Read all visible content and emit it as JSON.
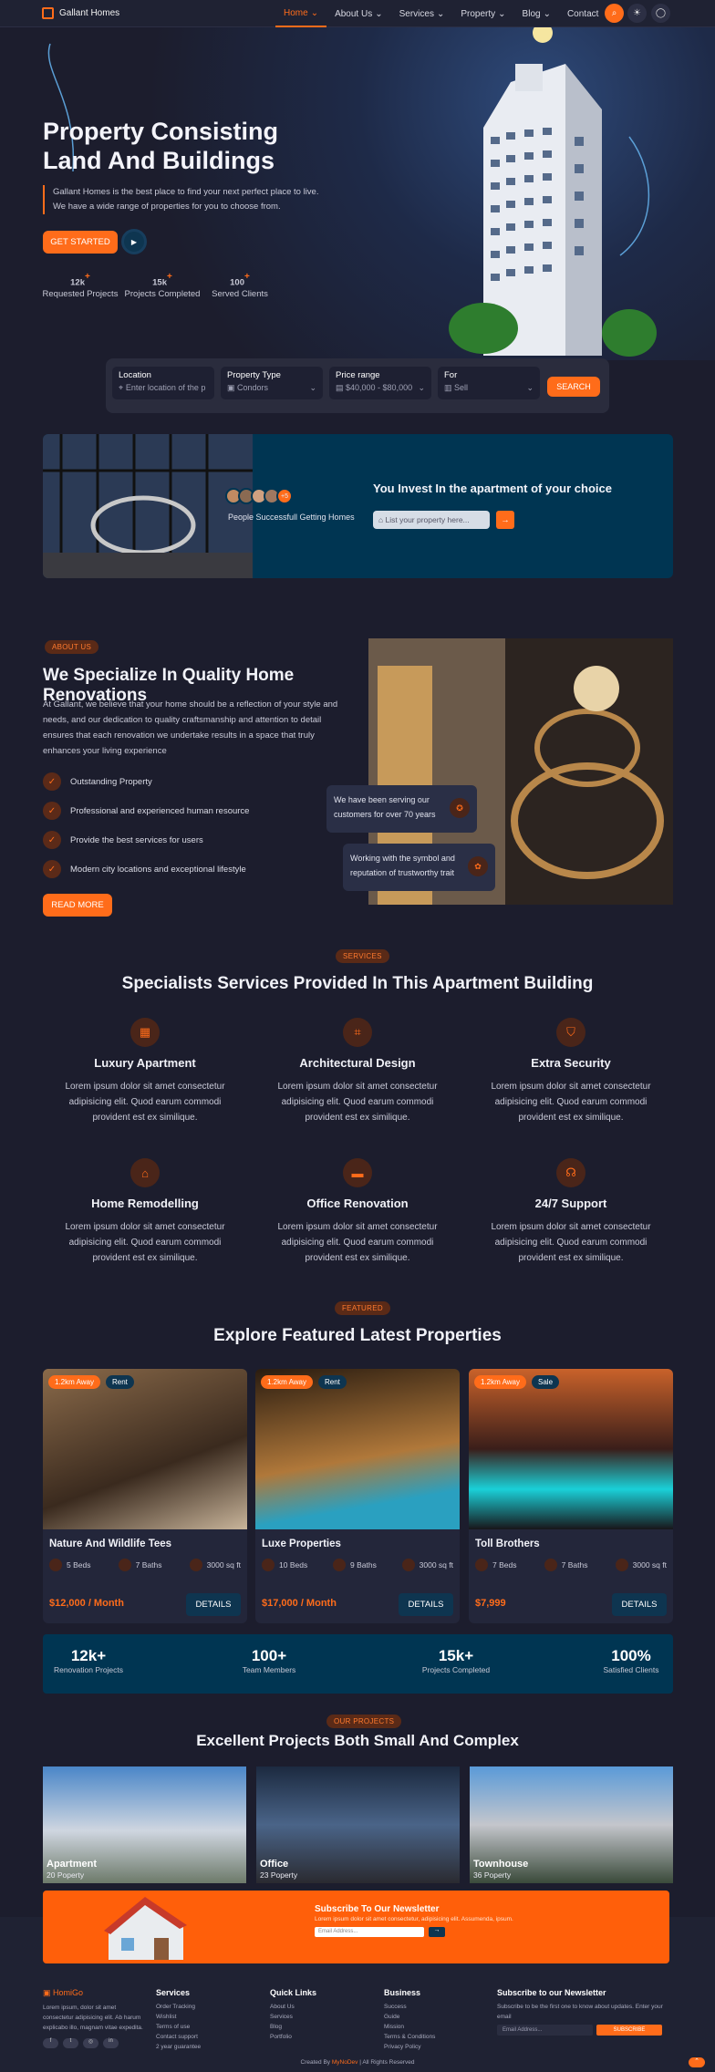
{
  "header": {
    "logo": "Gallant Homes",
    "nav": [
      "Home",
      "About Us",
      "Services",
      "Property",
      "Blog",
      "Contact"
    ]
  },
  "hero": {
    "title": "Property Consisting Land And Buildings",
    "desc": "Gallant Homes is the best place to find your next perfect place to live. We have a wide range of properties for you to choose from.",
    "cta": "GET STARTED",
    "stats": [
      {
        "value": "12k",
        "plus": "+",
        "label": "Requested Projects"
      },
      {
        "value": "15k",
        "plus": "+",
        "label": "Projects Completed"
      },
      {
        "value": "100",
        "plus": "+",
        "label": "Served Clients"
      }
    ]
  },
  "search": {
    "fields": [
      {
        "label": "Location",
        "value": "Enter location of the p"
      },
      {
        "label": "Property Type",
        "value": "Condors"
      },
      {
        "label": "Price range",
        "value": "$40,000 - $80,000"
      },
      {
        "label": "For",
        "value": "Sell"
      }
    ],
    "button": "SEARCH"
  },
  "banner": {
    "people": "People Successfull Getting Homes",
    "avatar_more": "+5",
    "title": "You Invest In the apartment of your choice",
    "placeholder": "List your property here..."
  },
  "about": {
    "tag": "ABOUT US",
    "title": "We Specialize In Quality Home Renovations",
    "text": "At Gallant, we believe that your home should be a reflection of your style and needs, and our dedication to quality craftsmanship and attention to detail ensures that each renovation we undertake results in a space that truly enhances your living experience",
    "list": [
      "Outstanding Property",
      "Professional and experienced human resource",
      "Provide the best services for users",
      "Modern city locations and exceptional lifestyle"
    ],
    "button": "READ MORE",
    "badge1": "We have been serving our customers for over 70 years",
    "badge2": "Working with the symbol and reputation of trustworthy trait"
  },
  "services": {
    "tag": "SERVICES",
    "title": "Specialists Services Provided In This Apartment Building",
    "desc": "Lorem ipsum dolor sit amet consectetur adipisicing elit. Quod earum commodi provident est ex similique.",
    "items": [
      {
        "name": "Luxury Apartment",
        "icon": "building-icon"
      },
      {
        "name": "Architectural Design",
        "icon": "design-icon"
      },
      {
        "name": "Extra Security",
        "icon": "shield-icon"
      },
      {
        "name": "Home Remodelling",
        "icon": "home-icon"
      },
      {
        "name": "Office Renovation",
        "icon": "paint-roller-icon"
      },
      {
        "name": "24/7 Support",
        "icon": "headset-icon"
      }
    ]
  },
  "featured": {
    "tag": "FEATURED",
    "title": "Explore Featured Latest Properties",
    "cards": [
      {
        "away": "1.2km Away",
        "type": "Rent",
        "name": "Nature And Wildlife Tees",
        "beds": "5 Beds",
        "baths": "7 Baths",
        "area": "3000 sq ft",
        "price": "$12,000 / Month"
      },
      {
        "away": "1.2km Away",
        "type": "Rent",
        "name": "Luxe Properties",
        "beds": "10 Beds",
        "baths": "9 Baths",
        "area": "3000 sq ft",
        "price": "$17,000 / Month"
      },
      {
        "away": "1.2km Away",
        "type": "Sale",
        "name": "Toll Brothers",
        "beds": "7 Beds",
        "baths": "7 Baths",
        "area": "3000 sq ft",
        "price": "$7,999"
      }
    ],
    "details": "DETAILS"
  },
  "numbers": [
    {
      "value": "12k+",
      "label": "Renovation Projects"
    },
    {
      "value": "100+",
      "label": "Team Members"
    },
    {
      "value": "15k+",
      "label": "Projects Completed"
    },
    {
      "value": "100%",
      "label": "Satisfied Clients"
    }
  ],
  "projects": {
    "tag": "OUR PROJECTS",
    "title": "Excellent Projects Both Small And Complex",
    "items": [
      {
        "name": "Apartment",
        "count": "20 Poperty"
      },
      {
        "name": "Office",
        "count": "23 Poperty"
      },
      {
        "name": "Townhouse",
        "count": "36 Poperty"
      }
    ]
  },
  "newsletter": {
    "title": "Subscribe To Our Newsletter",
    "desc": "Lorem ipsum dolor sit amet consectetur, adipisicing elit. Assumenda, ipsum.",
    "placeholder": "Email Address..."
  },
  "footer": {
    "brand": "HomiGo",
    "about": "Lorem ipsum, dolor sit amet consectetur adipisicing elit. Ab harum explicabo illo, magnam vitae expedita.",
    "services": {
      "title": "Services",
      "items": [
        "Order Tracking",
        "Wishlist",
        "Terms of use",
        "Contact support",
        "2 year guarantee"
      ]
    },
    "quick": {
      "title": "Quick Links",
      "items": [
        "About Us",
        "Services",
        "Blog",
        "Portfolio"
      ]
    },
    "business": {
      "title": "Business",
      "items": [
        "Success",
        "Guide",
        "Mission",
        "Terms & Conditions",
        "Privacy Policy"
      ]
    },
    "sub": {
      "title": "Subscribe to our Newsletter",
      "desc": "Subscribe to be the first one to know about updates. Enter your email",
      "placeholder": "Email Address...",
      "button": "SUBSCRIBE"
    },
    "copyright": "Created By",
    "copy_brand": "MyNoDev",
    "copy_rest": "| All Rights Reserved"
  },
  "colors": {
    "accent": "#ff6c1a",
    "teal": "#003552",
    "bg": "#1c1d2d"
  }
}
